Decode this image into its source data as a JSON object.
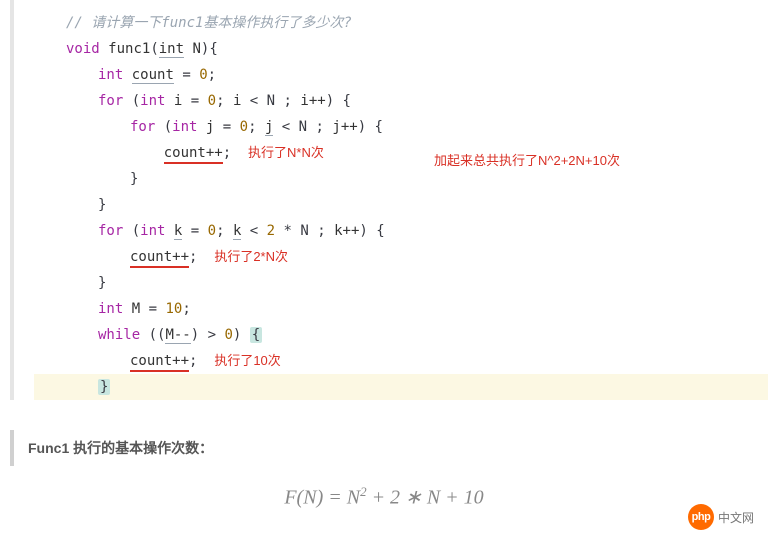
{
  "code": {
    "comment": "// 请计算一下func1基本操作执行了多少次?",
    "kw_void": "void",
    "fn_name": "func1",
    "kw_int": "int",
    "param_N": "N",
    "var_count": "count",
    "eq_zero": " = ",
    "zero": "0",
    "kw_for": "for",
    "var_i": "i",
    "var_j": "j",
    "var_k": "k",
    "two": "2",
    "lt_N": " < N",
    "lt_2N": " < ",
    "starN": " * N",
    "ipp": "i++",
    "jpp": "j++",
    "kpp": "k++",
    "countpp": "count++",
    "var_M": "M",
    "ten": "10",
    "kw_while": "while",
    "M_cond": "((",
    "Mdec": "M--",
    "gt0": ") > ",
    "close_paren": ") ",
    "open_brace": "{",
    "close_brace": "}",
    "semicolon": ";"
  },
  "annotations": {
    "exec_NN": "执行了N*N次",
    "exec_2N": "执行了2*N次",
    "exec_10": "执行了10次",
    "total": "加起来总共执行了N^2+2N+10次"
  },
  "summary": {
    "label": "Func1 执行的基本操作次数：",
    "formula": "F(N) = N² + 2 ∗ N + 10"
  },
  "logo": {
    "badge": "php",
    "text": "中文网"
  }
}
